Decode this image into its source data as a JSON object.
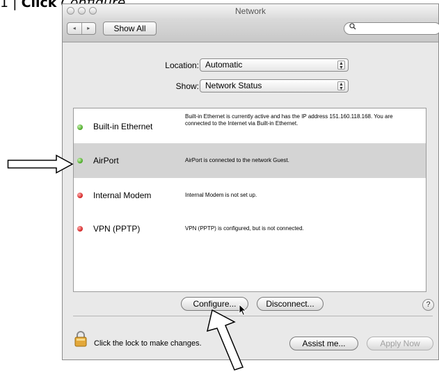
{
  "caption": {
    "step": "1 |",
    "bold": "Click",
    "italic": "Configure..."
  },
  "window": {
    "title": "Network"
  },
  "toolbar": {
    "back_forward": [
      "◂",
      "▸"
    ],
    "show_all_label": "Show All",
    "search_placeholder": ""
  },
  "location": {
    "label": "Location:",
    "value": "Automatic"
  },
  "show": {
    "label": "Show:",
    "value": "Network Status"
  },
  "services": [
    {
      "name": "Built-in Ethernet",
      "status": "green",
      "description": "Built-in Ethernet is currently active and has the IP address 151.160.118.168. You are connected to the Internet via Built-in Ethernet."
    },
    {
      "name": "AirPort",
      "status": "green",
      "selected": true,
      "description": "AirPort is connected to the network Guest."
    },
    {
      "name": "Internal Modem",
      "status": "red",
      "description": "Internal Modem is not set up."
    },
    {
      "name": "VPN (PPTP)",
      "status": "red",
      "description": "VPN (PPTP) is configured, but is not connected."
    }
  ],
  "buttons": {
    "configure": "Configure...",
    "disconnect": "Disconnect...",
    "help": "?",
    "assist": "Assist me...",
    "apply": "Apply Now"
  },
  "lock_text": "Click the lock to make changes.",
  "icons": {
    "search": "magnifier-icon",
    "lock": "padlock-icon",
    "arrow": "outline-arrow-icon"
  },
  "colors": {
    "status_green": "#47a623",
    "status_red": "#d21f1f",
    "selection": "#d4d4d4"
  }
}
